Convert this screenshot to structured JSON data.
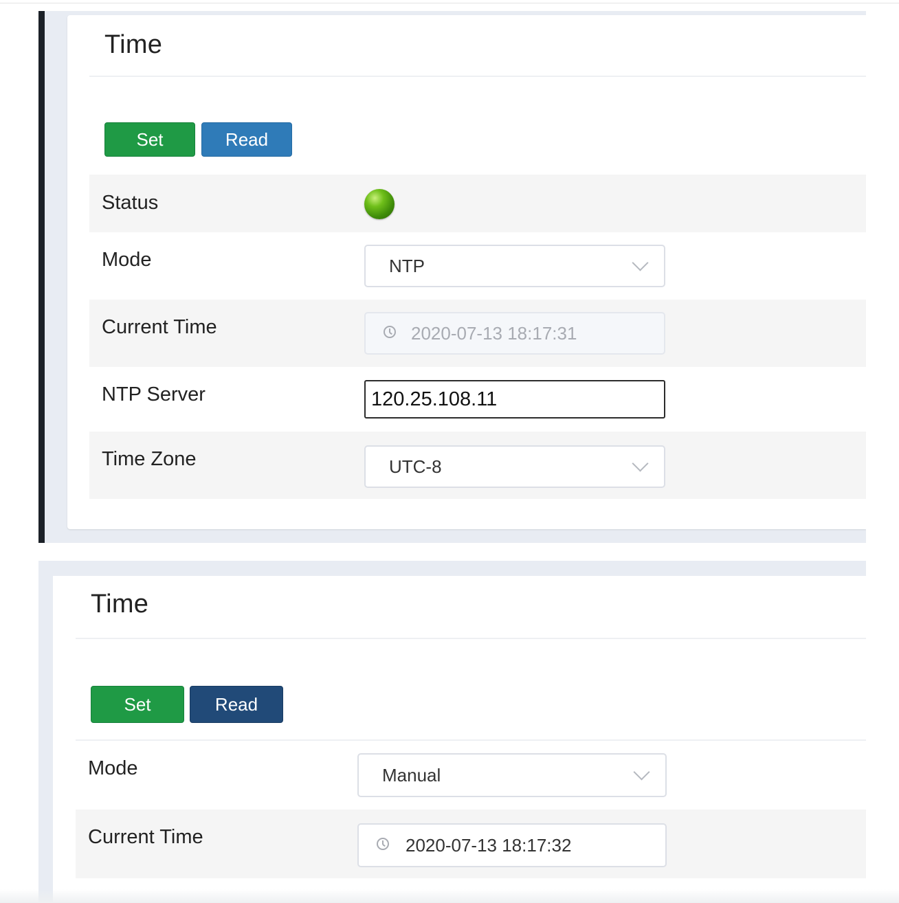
{
  "panel_ntp": {
    "title": "Time",
    "buttons": {
      "set_label": "Set",
      "read_label": "Read"
    },
    "rows": {
      "status": {
        "label": "Status",
        "indicator": "green-led",
        "color": "#4caf1a"
      },
      "mode": {
        "label": "Mode",
        "value": "NTP"
      },
      "current_time": {
        "label": "Current Time",
        "value": "2020-07-13 18:17:31"
      },
      "ntp_server": {
        "label": "NTP Server",
        "value": "120.25.108.11"
      },
      "time_zone": {
        "label": "Time Zone",
        "value": "UTC-8"
      }
    }
  },
  "panel_manual": {
    "title": "Time",
    "buttons": {
      "set_label": "Set",
      "read_label": "Read"
    },
    "rows": {
      "mode": {
        "label": "Mode",
        "value": "Manual"
      },
      "current_time": {
        "label": "Current Time",
        "value": "2020-07-13 18:17:32"
      }
    }
  },
  "colors": {
    "set_button": "#1f9a45",
    "read_button": "#2f7bb8",
    "read_button_active": "#214a78",
    "panel_background": "#e8ecf3"
  }
}
